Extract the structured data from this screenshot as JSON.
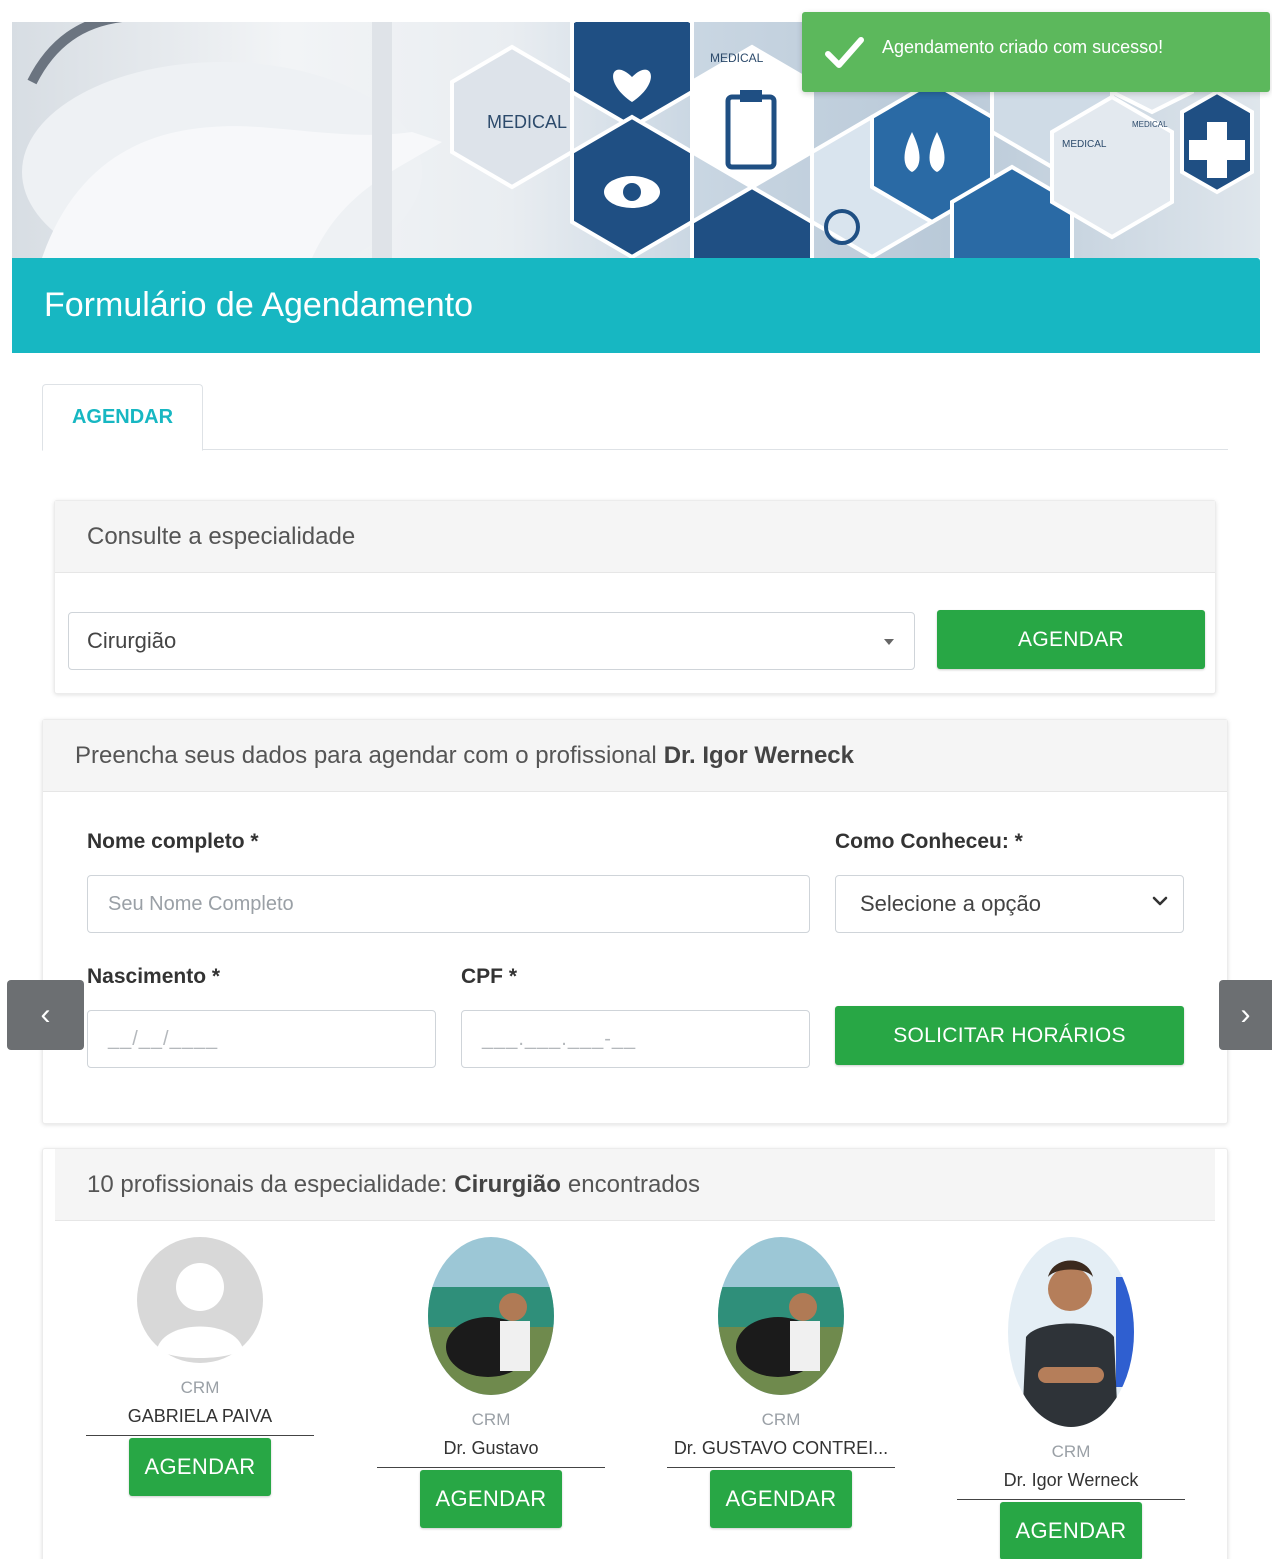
{
  "toast": {
    "message": "Agendamento criado com sucesso!",
    "icon": "check-icon",
    "color": "#5cb85c"
  },
  "banner": {
    "label_1": "MEDICAL",
    "label_2": "MEDICAL",
    "label_3": "MEDICAL",
    "label_4": "MEDICAL"
  },
  "header": {
    "title": "Formulário de Agendamento",
    "color": "#17b7c2"
  },
  "tabs": [
    {
      "label": "AGENDAR",
      "active": true
    }
  ],
  "specialty": {
    "heading": "Consulte a especialidade",
    "selected": "Cirurgião",
    "button_label": "AGENDAR"
  },
  "form": {
    "heading_prefix": "Preencha seus dados para agendar com o profissional",
    "professional": "Dr. Igor Werneck",
    "name_label": "Nome completo *",
    "name_placeholder": "Seu Nome Completo",
    "source_label": "Como Conheceu: *",
    "source_selected": "Selecione a opção",
    "birth_label": "Nascimento *",
    "birth_mask": "__/__/____",
    "cpf_label": "CPF *",
    "cpf_mask": "___.___.___-__",
    "submit_label": "SOLICITAR HORÁRIOS"
  },
  "carousel": {
    "prev": "‹",
    "next": "›"
  },
  "professionals": {
    "heading_prefix": "10 profissionais da especialidade:",
    "specialty": "Cirurgião",
    "heading_suffix": "encontrados",
    "items": [
      {
        "crm": "CRM",
        "name": "GABRIELA PAIVA",
        "button": "AGENDAR",
        "photo": "avatar-placeholder"
      },
      {
        "crm": "CRM",
        "name": "Dr. Gustavo",
        "button": "AGENDAR",
        "photo": "man-with-dog-photo"
      },
      {
        "crm": "CRM",
        "name": "Dr. GUSTAVO CONTREI...",
        "button": "AGENDAR",
        "photo": "man-with-dog-photo"
      },
      {
        "crm": "CRM",
        "name": "Dr. Igor Werneck",
        "button": "AGENDAR",
        "photo": "doctor-in-scrubs-photo"
      }
    ]
  },
  "colors": {
    "primary_green": "#28a745",
    "accent_teal": "#17b7c2"
  }
}
